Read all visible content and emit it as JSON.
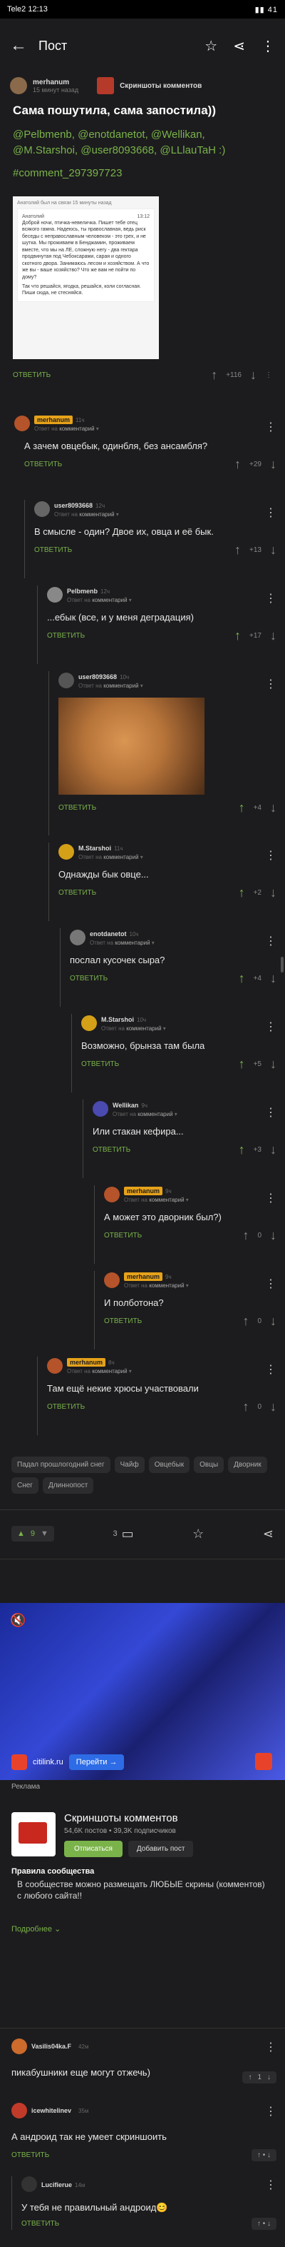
{
  "status_bar": {
    "carrier": "Tele2",
    "time": "12:13",
    "right": "▮▮ 41"
  },
  "appbar": {
    "title": "Пост"
  },
  "post": {
    "author": "merhanum",
    "time": "15 минут назад",
    "community": "Скриншоты комментов",
    "title": "Сама пошутила, сама запостила))",
    "tags_line": "@Pelbmenb, @enotdanetot, @Wellikan, @M.Starshoi, @user8093668, @LLlauTaH :)",
    "hashtag": "#comment_297397723",
    "image": {
      "caption": "Анатолий был на связи 15 минуты назад",
      "name": "Анатолий",
      "time": "13:12",
      "text": "Доброй ночи, птичка-невеличка. Пишет тебе отец всякого гамна. Надеюсь, ты православная, ведь риск беседы с неправославным человеком - это грех, и не шутка. Мы проживаем в Бенджамин, проживаем вместе, что мы на ЛЕ, сложную негу - два гектара продвинутая под Чебоксарами, сарая и одного скотного двора. Занимаюсь лесом и хозяйством. А что же вы - ваше хозяйство? Что же вам не пойти по дому?",
      "text2": "Так что решайся, ягодка, решайся, коли согласная. Пиши сюда, не стесняйся."
    },
    "reply_label": "ОТВЕТИТЬ",
    "score": "+116"
  },
  "comments": [
    {
      "name": "merhanum",
      "time": "11ч",
      "sub_prefix": "Ответ на",
      "sub_link": "комментарий",
      "text": "А зачем овцебык, одинбля, без ансамбля?",
      "reply": "ОТВЕТИТЬ",
      "score": "+29"
    },
    {
      "name": "user8093668",
      "time": "12ч",
      "sub_prefix": "Ответ на",
      "sub_link": "комментарий",
      "text": "В смысле - один? Двое их, овца и её бык.",
      "reply": "ОТВЕТИТЬ",
      "score": "+13"
    },
    {
      "name": "Pelbmenb",
      "time": "12ч",
      "sub_prefix": "Ответ на",
      "sub_link": "комментарий",
      "text": "...ебык (все, и у меня деградация)",
      "reply": "ОТВЕТИТЬ",
      "score": "+17"
    },
    {
      "name": "user8093668",
      "time": "10ч",
      "sub_prefix": "Ответ на",
      "sub_link": "комментарий",
      "text": "",
      "reply": "ОТВЕТИТЬ",
      "score": "+4"
    },
    {
      "name": "M.Starshoi",
      "time": "11ч",
      "sub_prefix": "Ответ на",
      "sub_link": "комментарий",
      "text": "Однажды бык овце...",
      "reply": "ОТВЕТИТЬ",
      "score": "+2"
    },
    {
      "name": "enotdanetot",
      "time": "10ч",
      "sub_prefix": "Ответ на",
      "sub_link": "комментарий",
      "text": "послал кусочек сыра?",
      "reply": "ОТВЕТИТЬ",
      "score": "+4"
    },
    {
      "name": "M.Starshoi",
      "time": "10ч",
      "sub_prefix": "Ответ на",
      "sub_link": "комментарий",
      "text": "Возможно, брынза там была",
      "reply": "ОТВЕТИТЬ",
      "score": "+5"
    },
    {
      "name": "Wellikan",
      "time": "9ч",
      "sub_prefix": "Ответ на",
      "sub_link": "комментарий",
      "text": "Или стакан кефира...",
      "reply": "ОТВЕТИТЬ",
      "score": "+3"
    },
    {
      "name": "merhanum",
      "time": "9ч",
      "sub_prefix": "Ответ на",
      "sub_link": "комментарий",
      "text": "А может это дворник был?)",
      "reply": "ОТВЕТИТЬ",
      "score": "0"
    },
    {
      "name": "merhanum",
      "time": "9ч",
      "sub_prefix": "Ответ на",
      "sub_link": "комментарий",
      "text": "И полботона?",
      "reply": "ОТВЕТИТЬ",
      "score": "0"
    },
    {
      "name": "merhanum",
      "time": "8ч",
      "sub_prefix": "Ответ на",
      "sub_link": "комментарий",
      "text": "Там ещё некие хрюсы участвовали",
      "reply": "ОТВЕТИТЬ",
      "score": "0"
    }
  ],
  "tags": [
    "Падал прошлогодний снег",
    "Чайф",
    "Овцебык",
    "Овцы",
    "Дворник",
    "Снег",
    "Длиннопост"
  ],
  "actions": {
    "rating": "9",
    "comments": "3"
  },
  "ad": {
    "site": "citilink.ru",
    "button": "Перейти →",
    "label": "Реклама"
  },
  "community": {
    "name": "Скриншоты комментов",
    "stats": "54,6K постов • 39,3K подписчиков",
    "subscribe": "Отписаться",
    "add_post": "Добавить пост",
    "rules_title": "Правила сообщества",
    "rules_text": "В сообществе можно размещать ЛЮБЫЕ скрины (комментов) с любого сайта!!",
    "more": "Подробнее"
  },
  "bottom_comments": [
    {
      "name": "Vasilis04ka.F",
      "time": "42м",
      "text": "пикабушники еще могут отжечь)",
      "score": "1"
    },
    {
      "name": "icewhitelinev",
      "time": "35м",
      "text": "А андроид так не умеет скриншоить",
      "reply": "ОТВЕТИТЬ"
    },
    {
      "name": "Lucifierue",
      "time": "14м",
      "text": "У тебя не правильный андроид😊",
      "reply": "ОТВЕТИТЬ"
    }
  ]
}
